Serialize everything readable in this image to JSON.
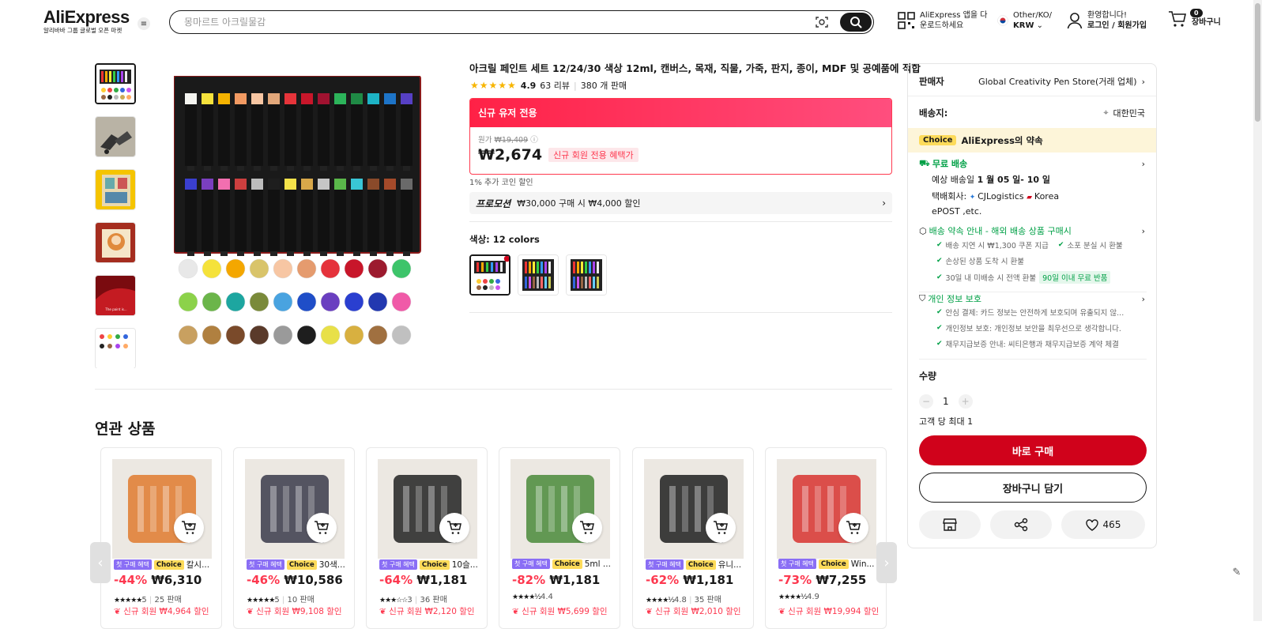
{
  "header": {
    "logo": "AliExpress",
    "logo_sub": "알리바바 그룹 글로벌 오픈 마켓",
    "search_placeholder": "몽마르트 아크릴물감",
    "app_download_line1": "AliExpress 앱을 다",
    "app_download_line2": "운로드하세요",
    "region_line1": "Other/KO/",
    "region_line2": "KRW",
    "account_line1": "환영합니다!",
    "account_line2": "로그인 / 회원가입",
    "cart_count": "0",
    "cart_label": "장바구니"
  },
  "product": {
    "title": "아크릴 페인트 세트 12/24/30 색상 12ml, 캔버스, 목재, 직물, 가죽, 판지, 종이, MDF 및 공예품에 적합",
    "rating": "4.9",
    "reviews": "63 리뷰",
    "sold": "380 개 판매",
    "promo_header": "신규 유저 전용",
    "original_label": "원가",
    "original_price": "₩19,409",
    "price": "₩2,674",
    "new_member_badge": "신규 회원 전용 혜택가",
    "coin_note": "1% 추가 코인 할인",
    "promotion_label": "프로모션",
    "promotion_text": "₩30,000 구매 시 ₩4,000 할인",
    "color_label": "색상: 12 colors"
  },
  "panel": {
    "seller_label": "판매자",
    "seller_value": "Global Creativity Pen Store(거래 업체)",
    "ship_to_label": "배송지:",
    "ship_to_value": "대한민국",
    "choice_tag": "Choice",
    "choice_promise": "AliExpress의 약속",
    "free_shipping": "무료 배송",
    "delivery_est_prefix": "예상 배송일",
    "delivery_est_date": "1 월 05 일- 10 일",
    "carrier_prefix": "택배회사:",
    "carrier_1": "CJLogistics",
    "carrier_2": "Korea",
    "carrier_3": "ePOST ,etc.",
    "guarantee_title": "배송 약속 안내 - 해외 배송 상품 구매시",
    "guarantees": [
      "배송 지연 시 ₩1,300 쿠폰 지급",
      "소포 분실 시 환불",
      "손상된 상품 도착 시 환불",
      "30일 내 미배송 시 전액 환불"
    ],
    "return_tag": "90일 이내 무료 반품",
    "privacy_title": "개인 정보 보호",
    "privacy_items": [
      "안심 결제: 카드 정보는 안전하게 보호되며 유출되지 않...",
      "개인정보 보호: 개인정보 보안을 최우선으로 생각합니다.",
      "채무지급보증 안내: 씨티은행과 채무지급보증 계약 체결"
    ],
    "qty_label": "수량",
    "qty_minus": "−",
    "qty_value": "1",
    "qty_plus": "+",
    "limit": "고객 당 최대 1",
    "buy_now": "바로 구매",
    "add_cart": "장바구니 담기",
    "wish_count": "465"
  },
  "related": {
    "title": "연관 상품",
    "first_tag": "첫 구매 혜택",
    "choice_tag": "Choice",
    "items": [
      {
        "name": "칼시...",
        "discount": "-44%",
        "price": "₩6,310",
        "stars": "★★★★★",
        "rating": "5",
        "sold": "25 판매",
        "bottom": "신규 회원 ₩4,964 할인",
        "color": "#e07a2e"
      },
      {
        "name": "30색...",
        "discount": "-46%",
        "price": "₩10,586",
        "stars": "★★★★★",
        "rating": "5",
        "sold": "10 판매",
        "bottom": "신규 회원 ₩9,108 할인",
        "color": "#3a3a4a"
      },
      {
        "name": "10슬...",
        "discount": "-64%",
        "price": "₩1,181",
        "stars": "★★★☆☆",
        "rating": "3",
        "sold": "36 판매",
        "bottom": "신규 회원 ₩2,120 할인",
        "color": "#222"
      },
      {
        "name": "5ml ...",
        "discount": "-82%",
        "price": "₩1,181",
        "stars": "★★★★½",
        "rating": "4.4",
        "sold": "",
        "bottom": "신규 회원 ₩5,699 할인",
        "color": "#4a8a3a"
      },
      {
        "name": "유니...",
        "discount": "-62%",
        "price": "₩1,181",
        "stars": "★★★★½",
        "rating": "4.8",
        "sold": "35 판매",
        "bottom": "신규 회원 ₩2,010 할인",
        "color": "#1e1e1e"
      },
      {
        "name": "Win...",
        "discount": "-73%",
        "price": "₩7,255",
        "stars": "★★★★½",
        "rating": "4.9",
        "sold": "",
        "bottom": "신규 회원 ₩19,994 할인",
        "color": "#d8322f"
      }
    ]
  },
  "colors": {
    "accent_red": "#d0021b",
    "promo_pink": "#ff2146",
    "choice_yellow": "#fddb5a",
    "green": "#00a046"
  }
}
